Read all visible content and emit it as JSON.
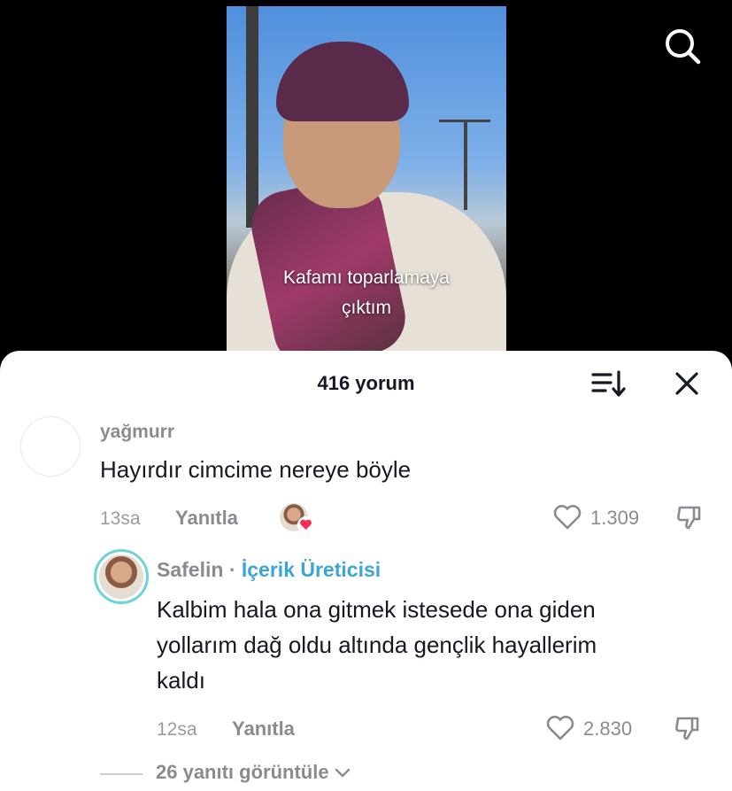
{
  "video": {
    "caption_line1": "Kafamı toparlamaya",
    "caption_line2": "çıktım"
  },
  "header": {
    "title": "416 yorum"
  },
  "icons": {
    "search": "search-icon",
    "sort": "sort-icon",
    "close": "close-icon"
  },
  "colors": {
    "creator_tag": "#3ba5d9",
    "liked_heart": "#fe2c55"
  },
  "comments": [
    {
      "username": "yağmurr",
      "text": "Hayırdır cimcime nereye böyle",
      "time": "13sa",
      "reply_label": "Yanıtla",
      "likes": "1.309",
      "liked_by_creator": true
    },
    {
      "username": "Safelin",
      "separator": "·",
      "creator_label": "İçerik Üreticisi",
      "text_line1": "Kalbim hala ona gitmek istesede ona giden",
      "text_line2": "yollarım dağ oldu altında gençlik hayallerim",
      "text_line3": "kaldı",
      "time": "12sa",
      "reply_label": "Yanıtla",
      "likes": "2.830"
    }
  ],
  "view_replies": "26 yanıtı görüntüle"
}
